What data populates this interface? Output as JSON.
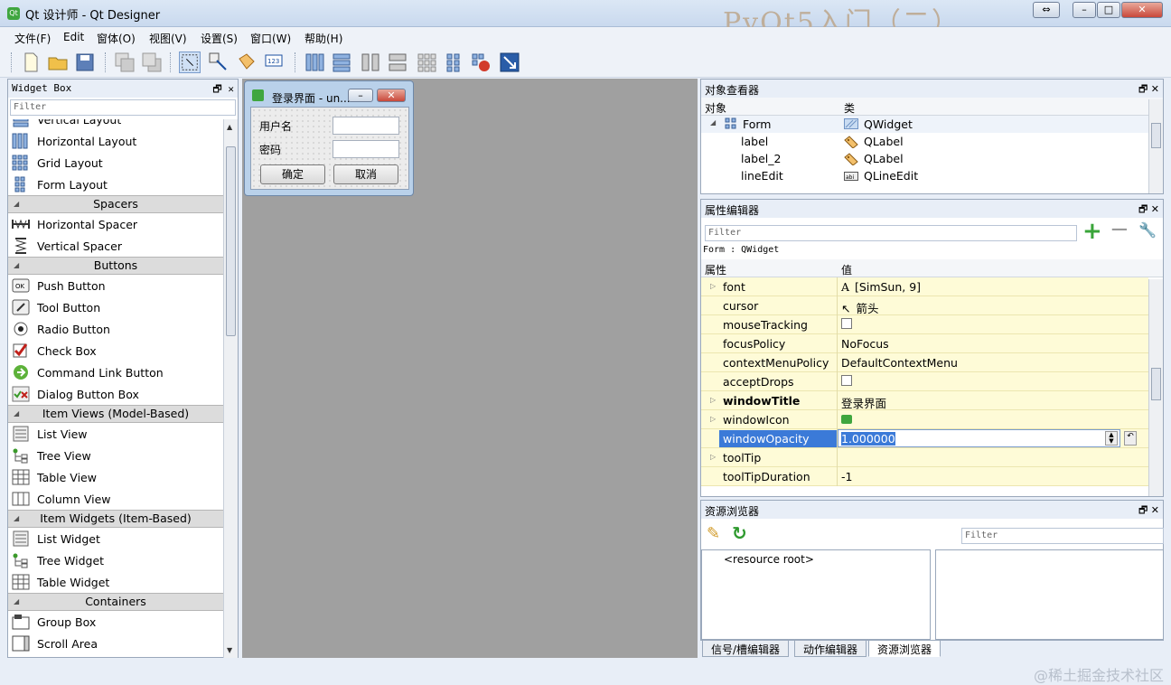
{
  "window": {
    "title": "Qt 设计师 - Qt Designer",
    "background_text": "PyQt5入门（二）"
  },
  "menu": [
    "文件(F)",
    "Edit",
    "窗体(O)",
    "视图(V)",
    "设置(S)",
    "窗口(W)",
    "帮助(H)"
  ],
  "widget_box": {
    "title": "Widget Box",
    "filter_placeholder": "Filter",
    "items": [
      {
        "type": "item",
        "label": "Vertical Layout",
        "icon": "vertical-layout-icon"
      },
      {
        "type": "item",
        "label": "Horizontal Layout",
        "icon": "horizontal-layout-icon"
      },
      {
        "type": "item",
        "label": "Grid Layout",
        "icon": "grid-layout-icon"
      },
      {
        "type": "item",
        "label": "Form Layout",
        "icon": "form-layout-icon"
      },
      {
        "type": "cat",
        "label": "Spacers"
      },
      {
        "type": "item",
        "label": "Horizontal Spacer",
        "icon": "horizontal-spacer-icon"
      },
      {
        "type": "item",
        "label": "Vertical Spacer",
        "icon": "vertical-spacer-icon"
      },
      {
        "type": "cat",
        "label": "Buttons"
      },
      {
        "type": "item",
        "label": "Push Button",
        "icon": "push-button-icon"
      },
      {
        "type": "item",
        "label": "Tool Button",
        "icon": "tool-button-icon"
      },
      {
        "type": "item",
        "label": "Radio Button",
        "icon": "radio-button-icon"
      },
      {
        "type": "item",
        "label": "Check Box",
        "icon": "check-box-icon"
      },
      {
        "type": "item",
        "label": "Command Link Button",
        "icon": "command-link-icon"
      },
      {
        "type": "item",
        "label": "Dialog Button Box",
        "icon": "dialog-button-box-icon"
      },
      {
        "type": "cat",
        "label": "Item Views (Model-Based)"
      },
      {
        "type": "item",
        "label": "List View",
        "icon": "list-view-icon"
      },
      {
        "type": "item",
        "label": "Tree View",
        "icon": "tree-view-icon"
      },
      {
        "type": "item",
        "label": "Table View",
        "icon": "table-view-icon"
      },
      {
        "type": "item",
        "label": "Column View",
        "icon": "column-view-icon"
      },
      {
        "type": "cat",
        "label": "Item Widgets (Item-Based)"
      },
      {
        "type": "item",
        "label": "List Widget",
        "icon": "list-widget-icon"
      },
      {
        "type": "item",
        "label": "Tree Widget",
        "icon": "tree-widget-icon"
      },
      {
        "type": "item",
        "label": "Table Widget",
        "icon": "table-widget-icon"
      },
      {
        "type": "cat",
        "label": "Containers"
      },
      {
        "type": "item",
        "label": "Group Box",
        "icon": "group-box-icon"
      },
      {
        "type": "item",
        "label": "Scroll Area",
        "icon": "scroll-area-icon"
      }
    ]
  },
  "form": {
    "title": "登录界面 - un...",
    "label_user": "用户名",
    "label_pass": "密码",
    "ok": "确定",
    "cancel": "取消"
  },
  "object_inspector": {
    "title": "对象查看器",
    "col_object": "对象",
    "col_class": "类",
    "rows": [
      {
        "object": "Form",
        "class": "QWidget"
      },
      {
        "object": "label",
        "class": "QLabel"
      },
      {
        "object": "label_2",
        "class": "QLabel"
      },
      {
        "object": "lineEdit",
        "class": "QLineEdit"
      }
    ]
  },
  "property_editor": {
    "title": "属性编辑器",
    "filter_placeholder": "Filter",
    "context": "Form : QWidget",
    "col_property": "属性",
    "col_value": "值",
    "rows": [
      {
        "name": "font",
        "value": "[SimSun, 9]",
        "expand": true,
        "bold": false,
        "kind": "font"
      },
      {
        "name": "cursor",
        "value": "箭头",
        "expand": false,
        "bold": false,
        "kind": "cursor"
      },
      {
        "name": "mouseTracking",
        "value": "",
        "expand": false,
        "bold": false,
        "kind": "check"
      },
      {
        "name": "focusPolicy",
        "value": "NoFocus",
        "expand": false,
        "bold": false,
        "kind": "text"
      },
      {
        "name": "contextMenuPolicy",
        "value": "DefaultContextMenu",
        "expand": false,
        "bold": false,
        "kind": "text"
      },
      {
        "name": "acceptDrops",
        "value": "",
        "expand": false,
        "bold": false,
        "kind": "check"
      },
      {
        "name": "windowTitle",
        "value": "登录界面",
        "expand": true,
        "bold": true,
        "kind": "text"
      },
      {
        "name": "windowIcon",
        "value": "",
        "expand": true,
        "bold": false,
        "kind": "icon"
      },
      {
        "name": "windowOpacity",
        "value": "1.000000",
        "expand": false,
        "bold": false,
        "kind": "edit"
      },
      {
        "name": "toolTip",
        "value": "",
        "expand": true,
        "bold": false,
        "kind": "text"
      },
      {
        "name": "toolTipDuration",
        "value": "-1",
        "expand": false,
        "bold": false,
        "kind": "text"
      }
    ]
  },
  "resource_browser": {
    "title": "资源浏览器",
    "filter_placeholder": "Filter",
    "root": "<resource root>"
  },
  "bottom_tabs": [
    "信号/槽编辑器",
    "动作编辑器",
    "资源浏览器"
  ],
  "watermark": "@稀土掘金技术社区"
}
